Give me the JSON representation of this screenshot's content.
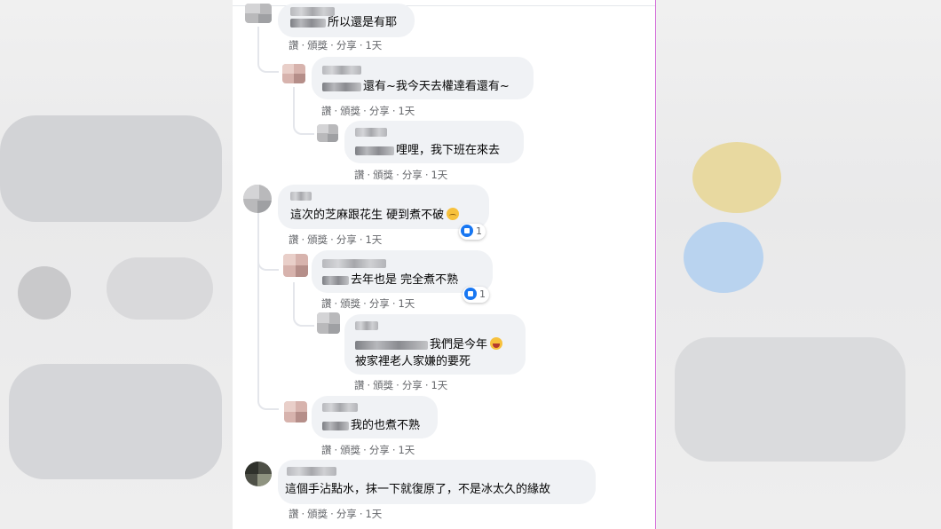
{
  "comments": [
    {
      "text": "所以還是有耶",
      "actions": [
        "讚",
        "頒獎",
        "分享",
        "1天"
      ]
    },
    {
      "text": "還有~我今天去權達看還有~",
      "actions": [
        "讚",
        "頒獎",
        "分享",
        "1天"
      ]
    },
    {
      "text": "哩哩，我下班在來去",
      "actions": [
        "讚",
        "頒獎",
        "分享",
        "1天"
      ]
    },
    {
      "text": "這次的芝麻跟花生 硬到煮不破",
      "actions": [
        "讚",
        "頒獎",
        "分享",
        "1天"
      ],
      "reactions": "1"
    },
    {
      "text": "去年也是 完全煮不熟",
      "actions": [
        "讚",
        "頒獎",
        "分享",
        "1天"
      ],
      "reactions": "1"
    },
    {
      "text_line1": "我們是今年",
      "text_line2": "被家裡老人家嫌的要死",
      "actions": [
        "讚",
        "頒獎",
        "分享",
        "1天"
      ]
    },
    {
      "text": "我的也煮不熟",
      "actions": [
        "讚",
        "頒獎",
        "分享",
        "1天"
      ]
    },
    {
      "text": "這個手沾點水，抹一下就復原了，不是冰太久的緣故",
      "actions": [
        "讚",
        "頒獎",
        "分享",
        "1天"
      ]
    }
  ],
  "colors": {
    "bubble": "#f0f2f5",
    "action_text": "#65676b",
    "like_blue": "#1877f2",
    "border_accent": "#d26ad8"
  }
}
